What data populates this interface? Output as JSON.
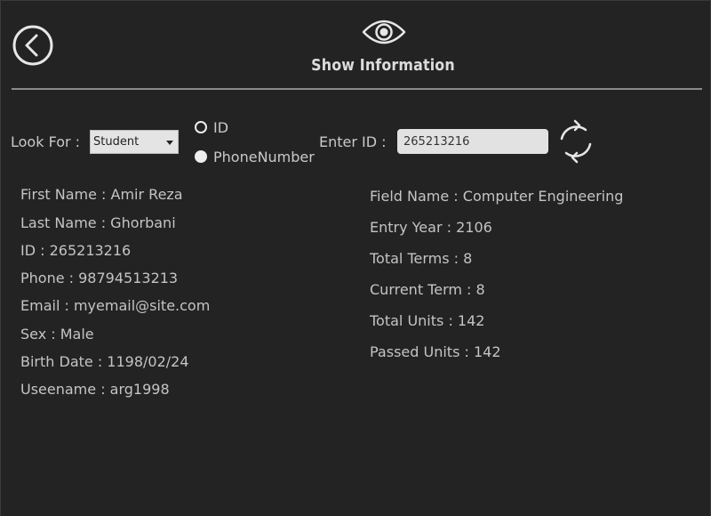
{
  "header": {
    "title": "Show Information",
    "back_icon": "back-arrow-icon",
    "title_icon": "eye-icon"
  },
  "search": {
    "look_for_label": "Look For :",
    "look_for_value": "Student",
    "radio_options": [
      {
        "label": "ID",
        "selected": false
      },
      {
        "label": "PhoneNumber",
        "selected": true
      }
    ],
    "enter_id_label": "Enter ID :",
    "id_value": "265213216",
    "refresh_icon": "refresh-icon"
  },
  "personal": [
    "First Name : Amir Reza",
    "Last Name : Ghorbani",
    "ID : 265213216",
    "Phone : 98794513213",
    "Email : myemail@site.com",
    "Sex : Male",
    "Birth Date : 1198/02/24",
    "Useename : arg1998"
  ],
  "academic": [
    "Field Name : Computer Engineering",
    "Entry Year : 2106",
    "Total Terms : 8",
    "Current Term : 8",
    "Total Units : 142",
    "Passed Units : 142"
  ],
  "colors": {
    "background": "#232323",
    "text": "#c4c4c4",
    "input": "#e2e2e2"
  }
}
